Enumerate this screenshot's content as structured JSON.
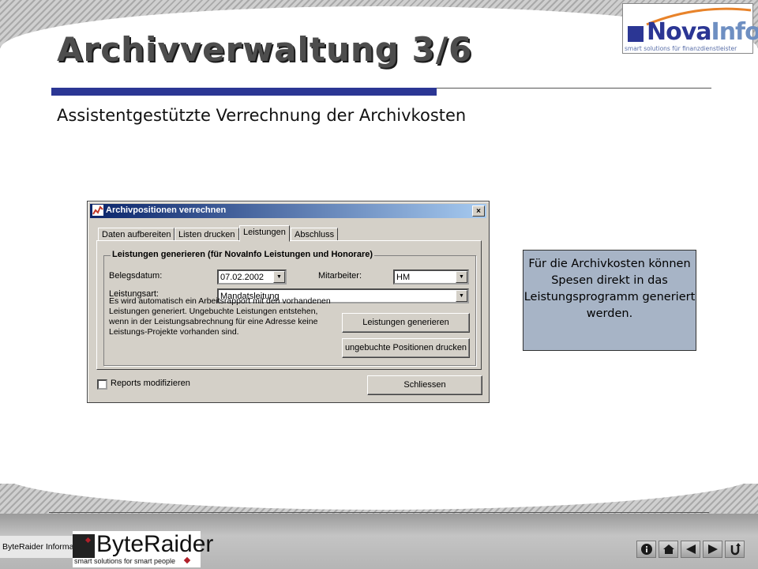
{
  "slide": {
    "title": "Archivverwaltung 3/6",
    "subtitle": "Assistentgestützte Verrechnung der Archivkosten"
  },
  "logo": {
    "nova": "Nova",
    "info": "Info",
    "tagline": "smart solutions für finanzdienstleister"
  },
  "dialog": {
    "title": "Archivpositionen verrechnen",
    "close_label": "×",
    "tabs": [
      {
        "label": "Daten aufbereiten"
      },
      {
        "label": "Listen drucken"
      },
      {
        "label": "Leistungen"
      },
      {
        "label": "Abschluss"
      }
    ],
    "active_tab": "Leistungen",
    "group_title": "Leistungen generieren (für NovaInfo Leistungen und Honorare)",
    "belegsdatum_label": "Belegsdatum:",
    "belegsdatum_value": "07.02.2002",
    "mitarbeiter_label": "Mitarbeiter:",
    "mitarbeiter_value": "HM",
    "leistungsart_label": "Leistungsart:",
    "leistungsart_value": "Mandatsleitung",
    "info_text": "Es wird automatisch ein Arbeitsrapport mit den vorhandenen Leistungen generiert. Ungebuchte Leistungen entstehen, wenn in der Leistungsabrechnung für eine Adresse keine Leistungs-Projekte vorhanden sind.",
    "generate_button": "Leistungen generieren",
    "print_button": "ungebuchte Positionen drucken",
    "reports_checkbox_label": "Reports modifizieren",
    "reports_checked": false,
    "close_button": "Schliessen"
  },
  "callout": {
    "text": "Für die Archivkosten können Spesen direkt in das Leistungsprogramm generiert werden."
  },
  "footer": {
    "company_name": "ByteRaider Informatik",
    "byteraider_word": "ByteRaider",
    "byteraider_tagline": "smart solutions for smart people",
    "nav_icons": [
      "info-icon",
      "home-icon",
      "previous-icon",
      "next-icon",
      "return-icon"
    ]
  },
  "colors": {
    "accent_blue": "#2b3694",
    "callout_bg": "#a7b4c6",
    "window_gray": "#d4d0c8",
    "titlebar_start": "#0a246a"
  }
}
